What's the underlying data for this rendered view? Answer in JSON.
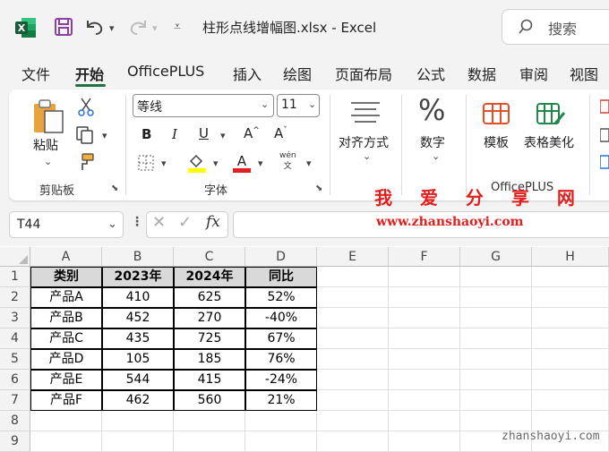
{
  "window": {
    "title": "柱形点线增幅图.xlsx  -  Excel",
    "search_placeholder": "搜索"
  },
  "menu_tabs": [
    "文件",
    "开始",
    "OfficePLUS",
    "插入",
    "绘图",
    "页面布局",
    "公式",
    "数据",
    "审阅",
    "视图"
  ],
  "active_tab": "开始",
  "ribbon": {
    "clipboard": {
      "paste_label": "粘贴",
      "group_label": "剪贴板"
    },
    "font": {
      "font_name": "等线",
      "font_size": "11",
      "phonetic_top": "wén",
      "phonetic_bottom": "文",
      "group_label": "字体",
      "fill_color": "#ffff00",
      "font_color": "#e02020"
    },
    "alignment": {
      "label": "对齐方式"
    },
    "number": {
      "label": "数字"
    },
    "officeplus": {
      "template_label": "模板",
      "table_beautify_label": "表格美化",
      "group_label": "OfficePLUS"
    }
  },
  "formula_bar": {
    "name_box": "T44",
    "fx_label": "fx"
  },
  "watermark": {
    "line1": "我 爱 分 享 网",
    "line2": "www.zhanshaoyi.com",
    "line3": "zhanshaoyi.com"
  },
  "sheet": {
    "columns": [
      "A",
      "B",
      "C",
      "D",
      "E",
      "F",
      "G",
      "H"
    ],
    "rows": [
      "1",
      "2",
      "3",
      "4",
      "5",
      "6",
      "7",
      "8",
      "9"
    ],
    "table": {
      "header": [
        "类别",
        "2023年",
        "2024年",
        "同比"
      ],
      "data": [
        [
          "产品A",
          "410",
          "625",
          "52%"
        ],
        [
          "产品B",
          "452",
          "270",
          "-40%"
        ],
        [
          "产品C",
          "435",
          "725",
          "67%"
        ],
        [
          "产品D",
          "105",
          "185",
          "76%"
        ],
        [
          "产品E",
          "544",
          "415",
          "-24%"
        ],
        [
          "产品F",
          "462",
          "560",
          "21%"
        ]
      ]
    }
  }
}
